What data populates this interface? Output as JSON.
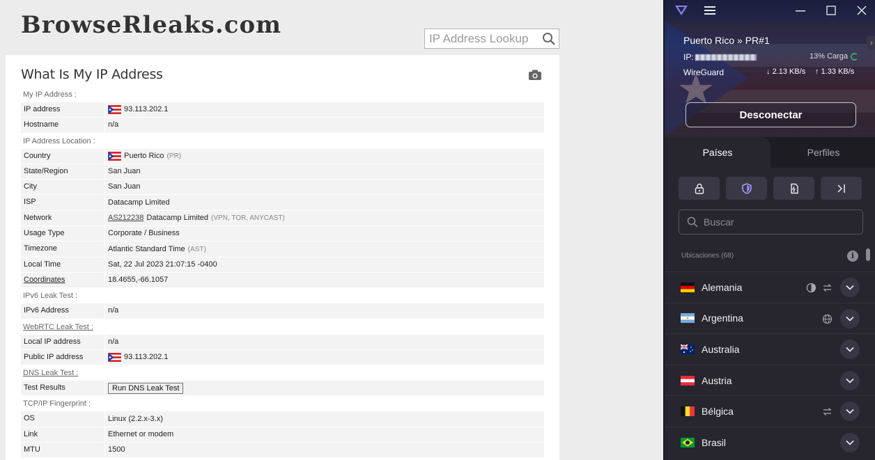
{
  "browser": {
    "logo_text": "BrowseRleaks.com",
    "lookup_placeholder": "IP Address Lookup",
    "page_title": "What Is My IP Address",
    "sections": [
      {
        "title": "My IP Address :",
        "link": false,
        "rows": [
          {
            "key": "IP address",
            "value": "93.113.202.1",
            "flag": "pr"
          },
          {
            "key": "Hostname",
            "value": "n/a"
          }
        ]
      },
      {
        "title": "IP Address Location :",
        "link": false,
        "rows": [
          {
            "key": "Country",
            "value": "Puerto Rico",
            "flag": "pr",
            "extra": "(PR)"
          },
          {
            "key": "State/Region",
            "value": "San Juan"
          },
          {
            "key": "City",
            "value": "San Juan"
          },
          {
            "key": "ISP",
            "value": "Datacamp Limited"
          },
          {
            "key": "Network",
            "link": "AS212238",
            "value": "Datacamp Limited",
            "extra": "(VPN, TOR, ANYCAST)"
          },
          {
            "key": "Usage Type",
            "value": "Corporate / Business"
          },
          {
            "key": "Timezone",
            "value": "Atlantic Standard Time",
            "extra": "(AST)"
          },
          {
            "key": "Local Time",
            "value": "Sat, 22 Jul 2023 21:07:15 -0400"
          },
          {
            "key": "Coordinates",
            "value": "18.4655,-66.1057",
            "key_link": true
          }
        ]
      },
      {
        "title": "IPv6 Leak Test :",
        "link": false,
        "rows": [
          {
            "key": "IPv6 Address",
            "value": "n/a"
          }
        ]
      },
      {
        "title": "WebRTC Leak Test :",
        "link": true,
        "rows": [
          {
            "key": "Local IP address",
            "value": "n/a"
          },
          {
            "key": "Public IP address",
            "value": "93.113.202.1",
            "flag": "pr"
          }
        ]
      },
      {
        "title": "DNS Leak Test :",
        "link": true,
        "rows": [
          {
            "key": "Test Results",
            "button": "Run DNS Leak Test"
          }
        ]
      },
      {
        "title": "TCP/IP Fingerprint :",
        "link": false,
        "rows": [
          {
            "key": "OS",
            "value": "Linux (2.2.x-3.x)"
          },
          {
            "key": "Link",
            "value": "Ethernet or modem"
          },
          {
            "key": "MTU",
            "value": "1500"
          }
        ]
      }
    ]
  },
  "vpn": {
    "server": "Puerto Rico » PR#1",
    "ip_label": "IP:",
    "load": "13% Carga",
    "protocol": "WireGuard",
    "download": "2.13 KB/s",
    "upload": "1.33 KB/s",
    "disconnect_label": "Desconectar",
    "tabs": [
      "Países",
      "Perfiles"
    ],
    "search_placeholder": "Buscar",
    "locations_header": "Ubicaciones (68)",
    "countries": [
      {
        "name": "Alemania",
        "flag": "de",
        "features": [
          "tor",
          "p2p"
        ]
      },
      {
        "name": "Argentina",
        "flag": "ar",
        "features": [
          "globe"
        ]
      },
      {
        "name": "Australia",
        "flag": "au",
        "features": []
      },
      {
        "name": "Austria",
        "flag": "at",
        "features": []
      },
      {
        "name": "Bélgica",
        "flag": "be",
        "features": [
          "p2p"
        ]
      },
      {
        "name": "Brasil",
        "flag": "br",
        "features": []
      }
    ],
    "colors": {
      "accent": "#6d4aff",
      "bg": "#27252e",
      "connected": "#3aa36c"
    }
  }
}
